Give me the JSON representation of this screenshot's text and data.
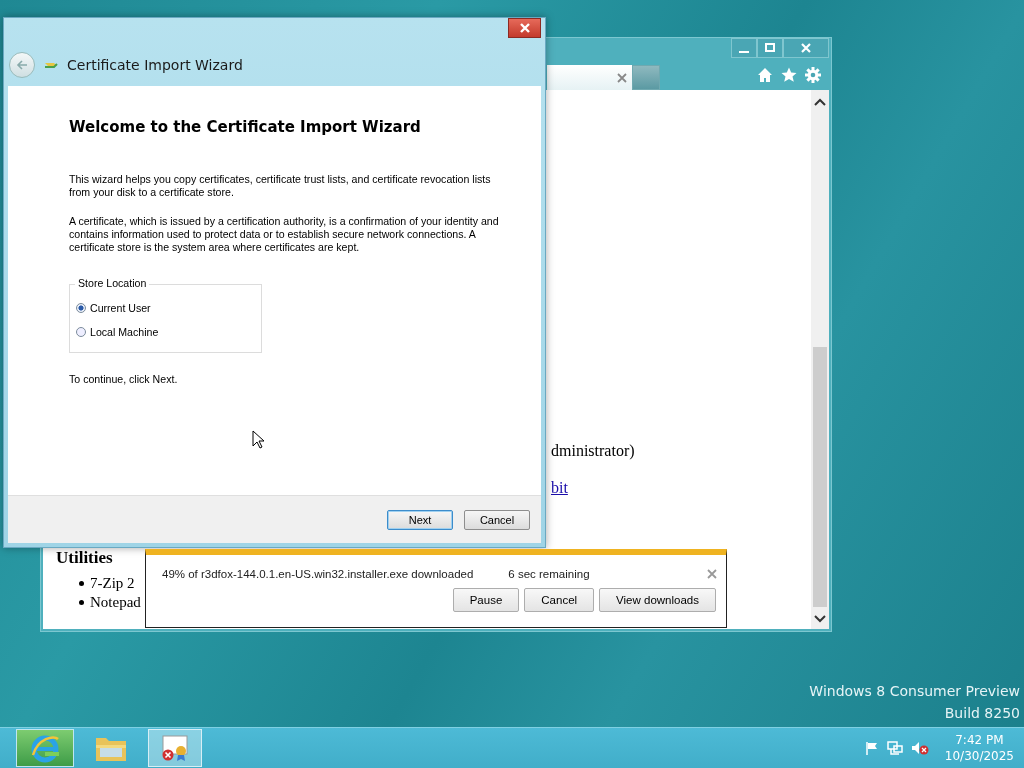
{
  "browser": {
    "content": {
      "fragment": "dministrator)",
      "link": "bit",
      "heading": "Utilities",
      "bullets": [
        "7-Zip 2",
        "Notepad"
      ]
    }
  },
  "wizard": {
    "title": "Certificate Import Wizard",
    "heading": "Welcome to the Certificate Import Wizard",
    "paragraphs": [
      "This wizard helps you copy certificates, certificate trust lists, and certificate revocation lists from your disk to a certificate store.",
      "A certificate, which is issued by a certification authority, is a confirmation of your identity and contains information used to protect data or to establish secure network connections. A certificate store is the system area where certificates are kept."
    ],
    "store_location": {
      "label": "Store Location",
      "options": [
        {
          "label": "Current User",
          "selected": true
        },
        {
          "label": "Local Machine",
          "selected": false
        }
      ]
    },
    "note": "To continue, click Next.",
    "buttons": [
      {
        "label": "Next",
        "default": true
      },
      {
        "label": "Cancel",
        "default": false
      }
    ]
  },
  "download_bar": {
    "message": "49% of r3dfox-144.0.1.en-US.win32.installer.exe downloaded",
    "remaining": "6 sec remaining",
    "buttons": [
      "Pause",
      "Cancel",
      "View downloads"
    ]
  },
  "desktop": {
    "watermark": [
      "Windows 8 Consumer Preview",
      "Build 8250"
    ]
  },
  "taskbar": {
    "apps": [
      {
        "kind": "browser"
      },
      {
        "kind": "folder"
      },
      {
        "kind": "certificate"
      }
    ],
    "time": "7:42 PM",
    "date": "10/30/2025"
  }
}
